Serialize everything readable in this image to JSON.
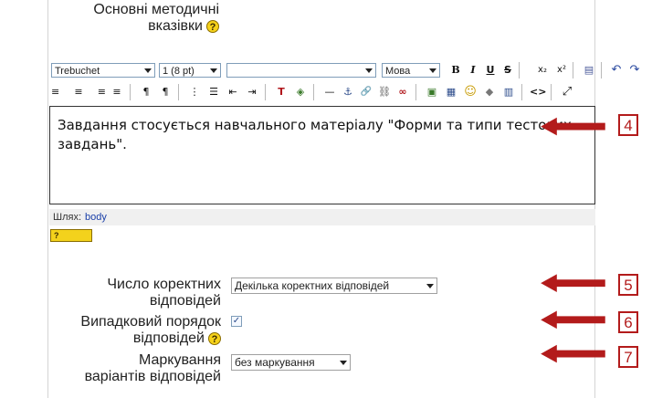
{
  "form": {
    "guidelines_label_1": "Основні методичні",
    "guidelines_label_2": "вказівки",
    "help": "?",
    "correct_answers_label_1": "Число коректних",
    "correct_answers_label_2": "відповідей",
    "correct_answers_value": "Декілька коректних відповідей",
    "shuffle_label_1": "Випадковий порядок",
    "shuffle_label_2": "відповідей",
    "shuffle_checked": "✓",
    "numbering_label_1": "Маркування",
    "numbering_label_2": "варіантів відповідей",
    "numbering_value": "без маркування"
  },
  "editor": {
    "font_family": "Trebuchet",
    "font_size": "1 (8 pt)",
    "format": "",
    "language": "Мова",
    "content": "Завдання стосується навчального матеріалу \"Форми та типи тестових завдань\".",
    "path_label": "Шлях:",
    "path_value": "body",
    "keyboard_label": "?"
  },
  "toolbar": {
    "bold": "B",
    "italic": "I",
    "underline": "U",
    "strike": "S",
    "subscript": "x₂",
    "superscript": "x²",
    "clean": "▤",
    "undo": "↶",
    "redo": "↷",
    "justify_left": "≡",
    "justify_center": "≡",
    "justify_right": "≡",
    "justify_full": "≡",
    "ltr": "¶",
    "rtl": "¶",
    "ordered_list": "⋮",
    "unordered_list": "☰",
    "outdent": "⇤",
    "indent": "⇥",
    "text_color": "T",
    "bg_color": "◈",
    "hr": "—",
    "anchor": "⚓",
    "link": "🔗",
    "unlink": "⛓",
    "nolink": "∞",
    "image": "▣",
    "table": "▦",
    "smiley": "☺",
    "special": "◆",
    "paste": "▥",
    "html": "<>",
    "fullscreen": "⤢"
  },
  "callouts": {
    "c4": "4",
    "c5": "5",
    "c6": "6",
    "c7": "7"
  },
  "colors": {
    "callout": "#b31b1b",
    "help": "#f6d21a",
    "link": "#1a3fa8"
  }
}
